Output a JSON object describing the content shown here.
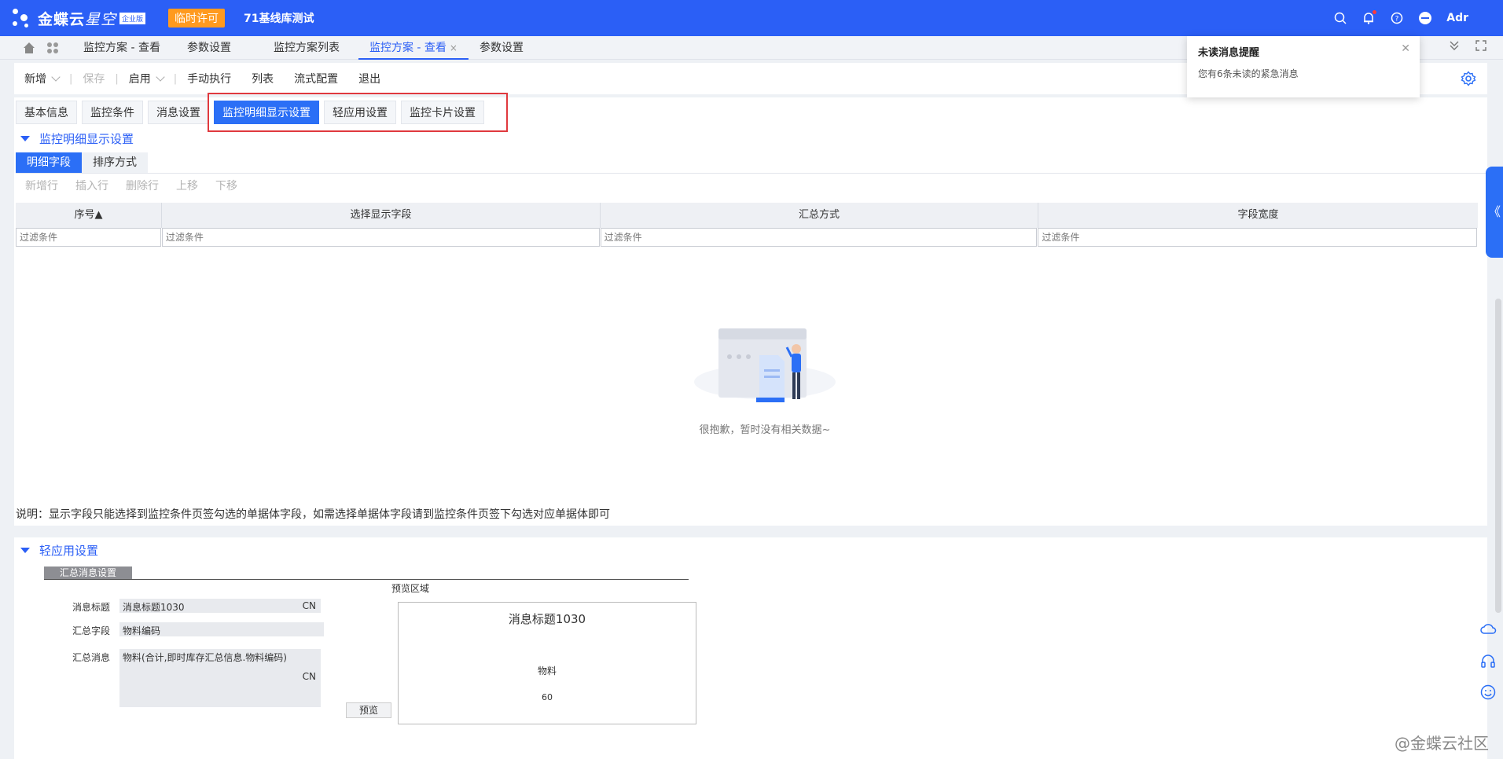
{
  "topbar": {
    "logo": "金蝶云",
    "logo_sub": "星空",
    "edition": "企业版",
    "license": "临时许可",
    "db_name": "71基线库测试",
    "user": "Adr"
  },
  "page_tabs": [
    {
      "label": "监控方案 - 查看"
    },
    {
      "label": "参数设置"
    },
    {
      "label": "监控方案列表"
    },
    {
      "label": "监控方案 - 查看",
      "close": "×"
    },
    {
      "label": "参数设置"
    }
  ],
  "toolbar": {
    "new": "新增",
    "save": "保存",
    "enable": "启用",
    "manual": "手动执行",
    "list": "列表",
    "flow": "流式配置",
    "exit": "退出"
  },
  "notification": {
    "title": "未读消息提醒",
    "body": "您有6条未读的紧急消息"
  },
  "subtabs": [
    "基本信息",
    "监控条件",
    "消息设置",
    "监控明细显示设置",
    "轻应用设置",
    "监控卡片设置"
  ],
  "detail_section": {
    "title": "监控明细显示设置",
    "tabs": [
      "明细字段",
      "排序方式"
    ],
    "tools": [
      "新增行",
      "插入行",
      "删除行",
      "上移",
      "下移"
    ],
    "columns": [
      "序号▲",
      "选择显示字段",
      "汇总方式",
      "字段宽度"
    ],
    "filter_placeholder": "过滤条件",
    "empty_text": "很抱歉，暂时没有相关数据~",
    "note": "说明：显示字段只能选择到监控条件页签勾选的单据体字段，如需选择单据体字段请到监控条件页签下勾选对应单据体即可"
  },
  "light_section": {
    "title": "轻应用设置",
    "summary_tab": "汇总消息设置",
    "preview_area": "预览区域",
    "msg_title_label": "消息标题",
    "msg_title_value": "消息标题1030",
    "cn": "CN",
    "sum_field_label": "汇总字段",
    "sum_field_value": "物料编码",
    "sum_msg_label": "汇总消息",
    "sum_msg_value": "物料(合计,即时库存汇总信息.物料编码)",
    "preview_button": "预览",
    "preview_title": "消息标题1030",
    "preview_item": "物料",
    "preview_value": "60"
  },
  "watermark": "@金蝶云社区",
  "colors": {
    "brand": "#2b5ff6",
    "license": "#ff9a1f",
    "highlight": "#e0393e"
  }
}
